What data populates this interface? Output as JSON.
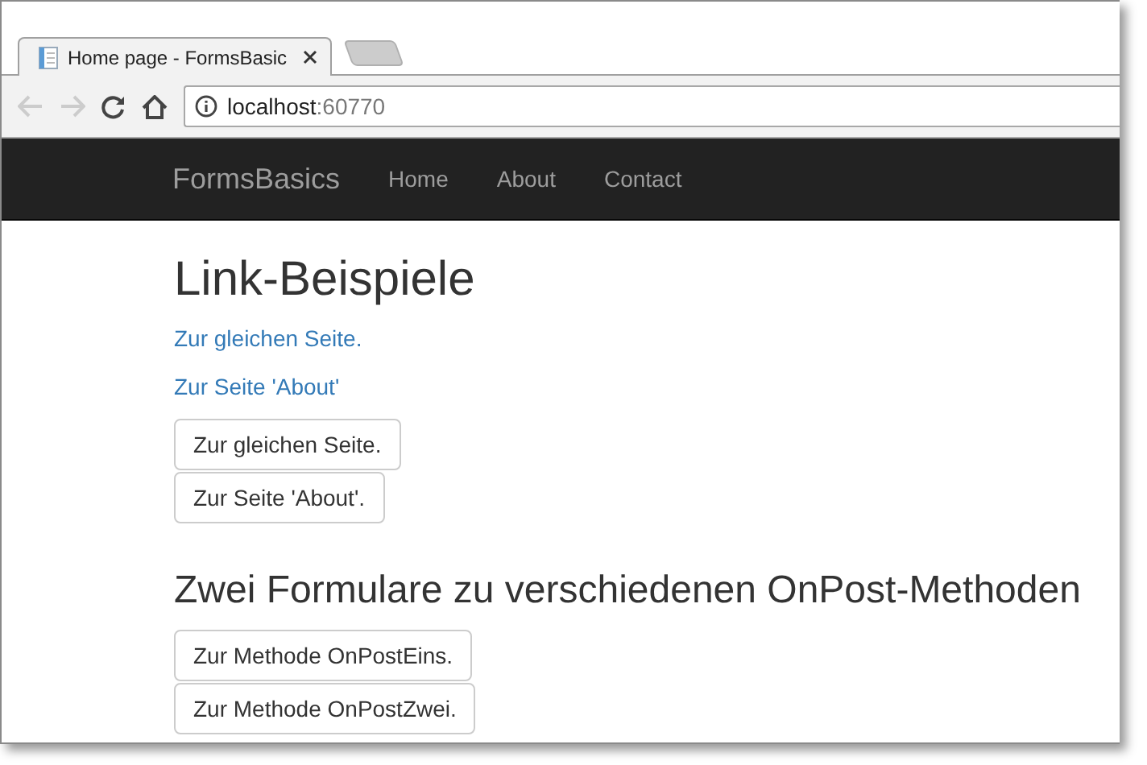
{
  "tab": {
    "title": "Home page - FormsBasic",
    "selected": true
  },
  "address": {
    "host": "localhost",
    "port": ":60770"
  },
  "navbar": {
    "brand": "FormsBasics",
    "items": [
      "Home",
      "About",
      "Contact"
    ]
  },
  "sections": [
    {
      "heading": "Link-Beispiele",
      "links": [
        "Zur gleichen Seite.",
        "Zur Seite 'About'"
      ],
      "buttons": [
        "Zur gleichen Seite.",
        "Zur Seite 'About'."
      ]
    },
    {
      "heading": "Zwei Formulare zu verschiedenen OnPost-Methoden",
      "buttons": [
        "Zur Methode OnPostEins.",
        "Zur Methode OnPostZwei."
      ]
    }
  ]
}
